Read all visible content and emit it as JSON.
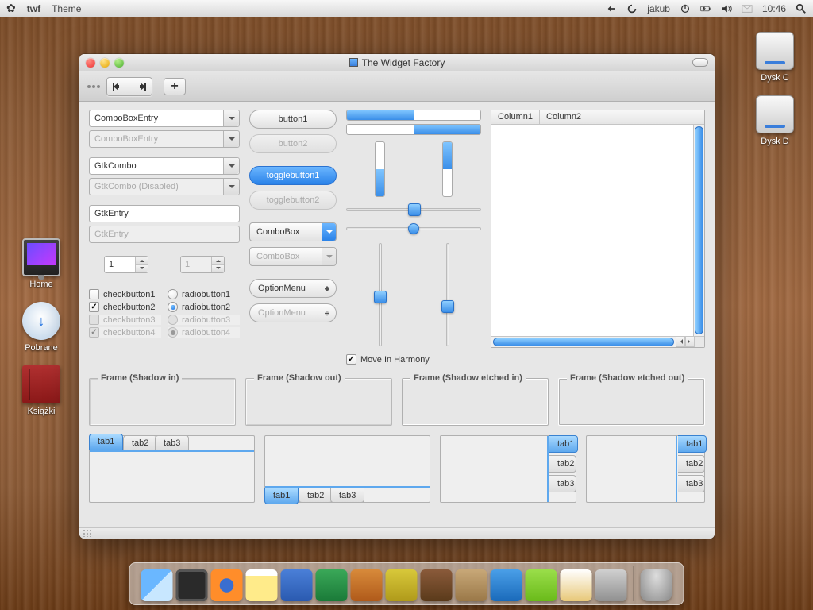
{
  "menubar": {
    "app": "twf",
    "menu1": "Theme",
    "user": "jakub",
    "time": "10:46"
  },
  "desktop": {
    "diskC": "Dysk C",
    "diskD": "Dysk D",
    "home": "Home",
    "downloads": "Pobrane",
    "books": "Książki"
  },
  "window": {
    "title": "The Widget Factory"
  },
  "col1": {
    "comboEntry": "ComboBoxEntry",
    "comboEntryDisabled": "ComboBoxEntry",
    "gtkCombo": "GtkCombo",
    "gtkComboDisabled": "GtkCombo (Disabled)",
    "entry": "GtkEntry",
    "entryDisabled": "GtkEntry",
    "spin1": "1",
    "spin2": "1",
    "cb1": "checkbutton1",
    "cb2": "checkbutton2",
    "cb3": "checkbutton3",
    "cb4": "checkbutton4",
    "rb1": "radiobutton1",
    "rb2": "radiobutton2",
    "rb3": "radiobutton3",
    "rb4": "radiobutton4"
  },
  "col2": {
    "button1": "button1",
    "button2": "button2",
    "toggle1": "togglebutton1",
    "toggle2": "togglebutton2",
    "combo": "ComboBox",
    "comboD": "ComboBox",
    "option": "OptionMenu",
    "optionD": "OptionMenu"
  },
  "col3": {
    "harmony": "Move In Harmony"
  },
  "col4": {
    "colA": "Column1",
    "colB": "Column2"
  },
  "frames": {
    "f1": "Frame (Shadow in)",
    "f2": "Frame (Shadow out)",
    "f3": "Frame (Shadow etched in)",
    "f4": "Frame (Shadow etched out)"
  },
  "tabs": {
    "t1": "tab1",
    "t2": "tab2",
    "t3": "tab3"
  }
}
